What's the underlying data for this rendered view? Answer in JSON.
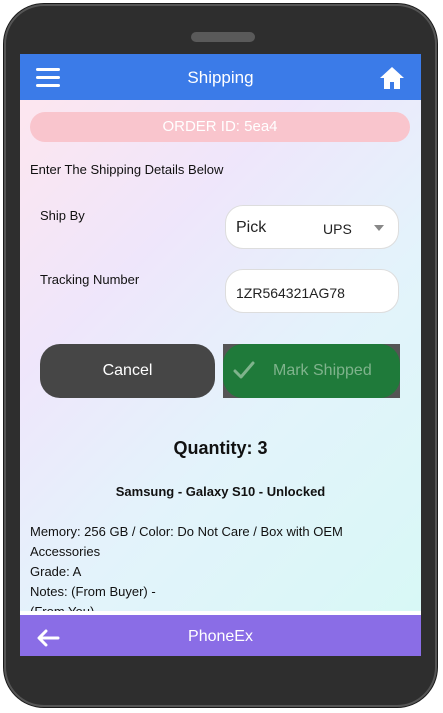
{
  "header": {
    "title": "Shipping"
  },
  "order": {
    "id_label": "ORDER ID: 5ea4"
  },
  "form": {
    "instructions": "Enter The Shipping Details Below",
    "ship_by_label": "Ship By",
    "ship_by_placeholder": "Pick",
    "ship_by_value": "UPS",
    "tracking_label": "Tracking Number",
    "tracking_value": "1ZR564321AG78"
  },
  "actions": {
    "cancel": "Cancel",
    "mark_shipped": "Mark Shipped"
  },
  "item": {
    "quantity": "Quantity: 3",
    "product": "Samsung - Galaxy S10 - Unlocked",
    "details": [
      "Memory: 256 GB / Color: Do Not Care / Box with OEM Accessories",
      "Grade: A",
      "Notes: (From Buyer) -",
      "(From You) -"
    ]
  },
  "footer": {
    "brand": "PhoneEx"
  },
  "colors": {
    "top_bar": "#3b7be8",
    "bottom_bar": "#8a6de6",
    "order_pill": "#f9c5cd",
    "mark_shipped": "#1f7a3a",
    "cancel": "#464646"
  },
  "icons": [
    "menu-icon",
    "home-icon",
    "chevron-down-icon",
    "check-icon",
    "arrow-left-icon"
  ]
}
